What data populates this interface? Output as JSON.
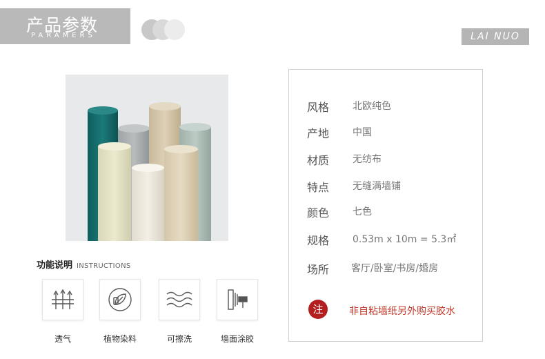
{
  "header": {
    "title": "产品参数",
    "subtitle": "PARAMERS",
    "brand": "LAI NUO"
  },
  "colors": {
    "banner": "#b9b9b9",
    "accent_red": "#b31e1e",
    "note_text": "#c0392b"
  },
  "specs": [
    {
      "key": "风格",
      "value": "北欧纯色"
    },
    {
      "key": "产地",
      "value": "中国"
    },
    {
      "key": "材质",
      "value": "无纺布"
    },
    {
      "key": "特点",
      "value": "无缝满墙铺"
    },
    {
      "key": "颜色",
      "value": "七色"
    },
    {
      "key": "规格",
      "value": "0.53m x 10m = 5.3㎡"
    },
    {
      "key": "场所",
      "value": "客厅/卧室/书房/婚房"
    }
  ],
  "note": {
    "badge": "注",
    "text": "非自粘墙纸另外购买胶水"
  },
  "instructions": {
    "title": "功能说明",
    "title_en": "INSTRUCTIONS",
    "features": [
      {
        "label": "透气",
        "icon": "breathable-icon"
      },
      {
        "label": "植物染料",
        "icon": "plant-dye-icon"
      },
      {
        "label": "可擦洗",
        "icon": "washable-icon"
      },
      {
        "label": "墙面涂胶",
        "icon": "wall-glue-icon"
      }
    ]
  }
}
